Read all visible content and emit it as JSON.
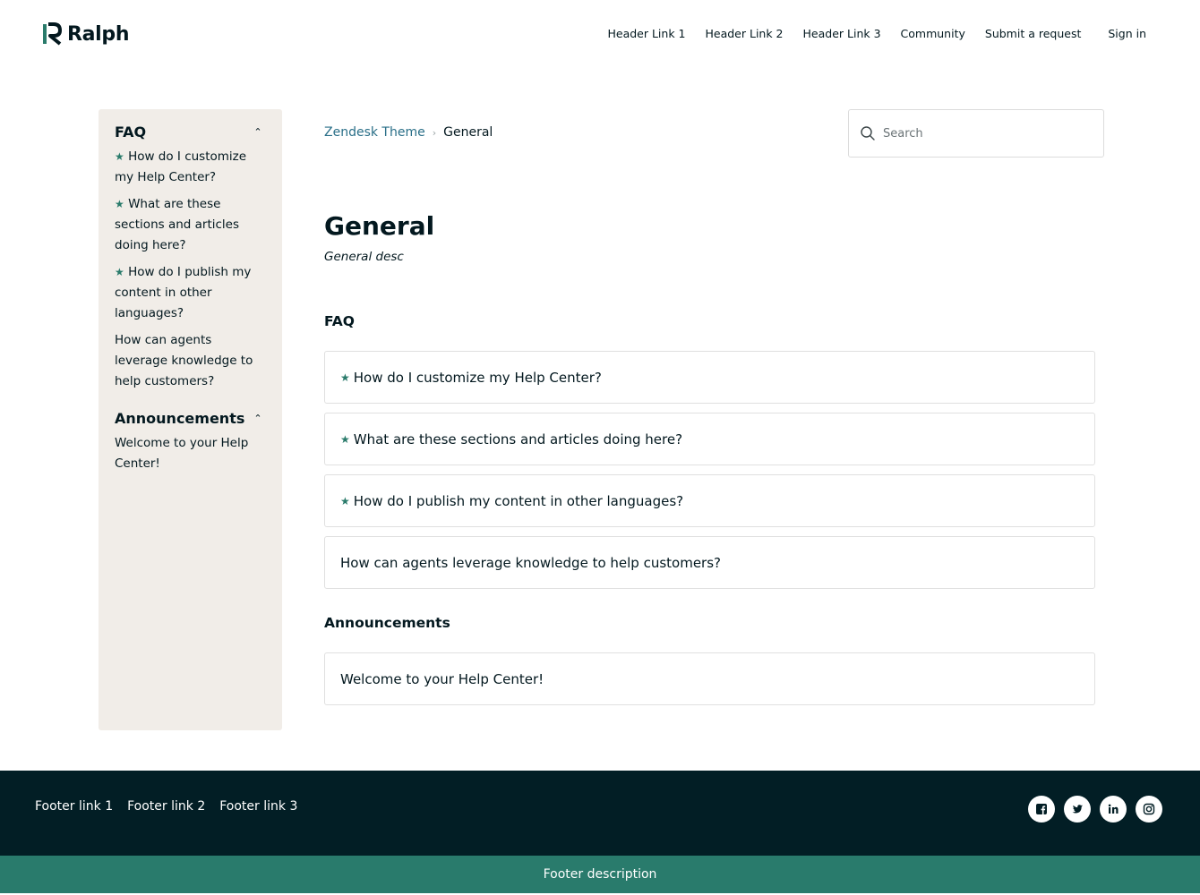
{
  "header": {
    "brand": "Ralph",
    "nav": [
      "Header Link 1",
      "Header Link 2",
      "Header Link 3",
      "Community",
      "Submit a request"
    ],
    "signin": "Sign in"
  },
  "sidebar": {
    "sections": [
      {
        "title": "FAQ",
        "items": [
          {
            "label": "How do I customize my Help Center?",
            "promoted": true
          },
          {
            "label": "What are these sections and articles doing here?",
            "promoted": true
          },
          {
            "label": "How do I publish my content in other languages?",
            "promoted": true
          },
          {
            "label": "How can agents leverage knowledge to help customers?",
            "promoted": false
          }
        ]
      },
      {
        "title": "Announcements",
        "items": [
          {
            "label": "Welcome to your Help Center!",
            "promoted": false
          }
        ]
      }
    ]
  },
  "breadcrumb": {
    "root": "Zendesk Theme",
    "current": "General"
  },
  "search": {
    "placeholder": "Search"
  },
  "main": {
    "title": "General",
    "description": "General desc",
    "sections": [
      {
        "title": "FAQ",
        "articles": [
          {
            "label": "How do I customize my Help Center?",
            "promoted": true
          },
          {
            "label": "What are these sections and articles doing here?",
            "promoted": true
          },
          {
            "label": "How do I publish my content in other languages?",
            "promoted": true
          },
          {
            "label": "How can agents leverage knowledge to help customers?",
            "promoted": false
          }
        ]
      },
      {
        "title": "Announcements",
        "articles": [
          {
            "label": "Welcome to your Help Center!",
            "promoted": false
          }
        ]
      }
    ]
  },
  "footer": {
    "links": [
      "Footer link 1",
      "Footer link 2",
      "Footer link 3"
    ],
    "social_icons": [
      "facebook-icon",
      "twitter-icon",
      "linkedin-icon",
      "instagram-icon"
    ],
    "description": "Footer description"
  },
  "colors": {
    "accent": "#297b6c",
    "footer_bg": "#021e25",
    "sidebar_bg": "#f1ede8",
    "link": "#2a6f88"
  }
}
